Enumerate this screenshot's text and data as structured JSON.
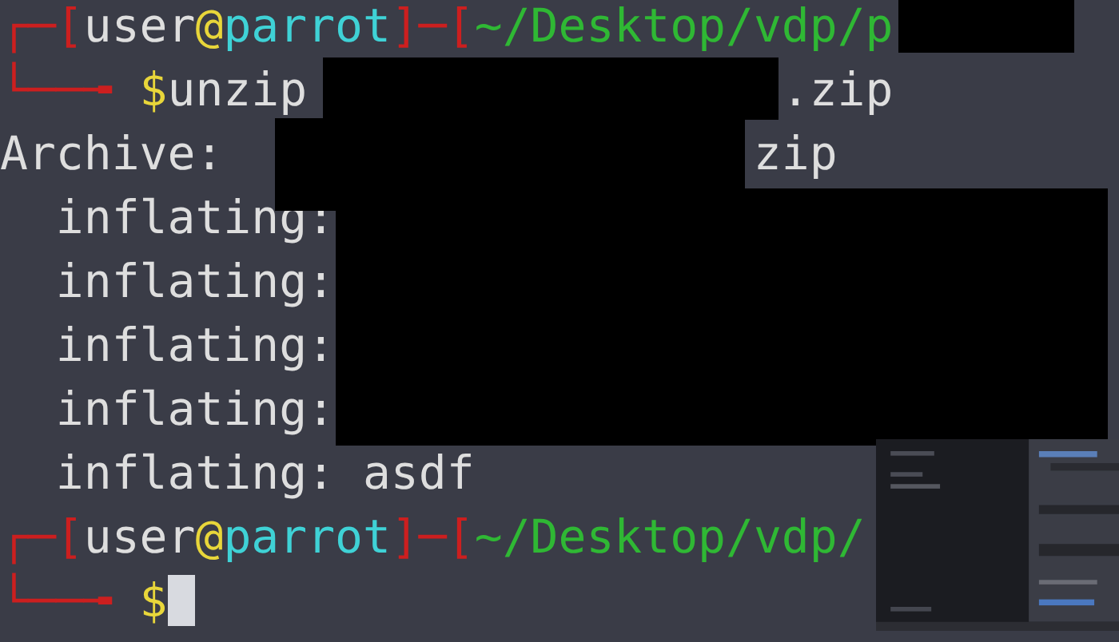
{
  "terminal": {
    "lines": [
      {
        "kind": "prompt_top",
        "segments": [
          {
            "kind": "frame",
            "text": "┌─["
          },
          {
            "kind": "user",
            "text": "user"
          },
          {
            "kind": "at",
            "text": "@"
          },
          {
            "kind": "host",
            "text": "parrot"
          },
          {
            "kind": "frame",
            "text": "]─["
          },
          {
            "kind": "path",
            "text": "~/Desktop/vdp/p"
          }
        ]
      },
      {
        "kind": "prompt_bottom",
        "segments": [
          {
            "kind": "frame",
            "text": "└──╼"
          },
          {
            "kind": "dollar",
            "text": "$"
          },
          {
            "kind": "command",
            "text": "unzip"
          },
          {
            "kind": "tail",
            "text": ".zip"
          }
        ]
      },
      {
        "kind": "output",
        "segments": [
          {
            "kind": "output",
            "text": "Archive:"
          },
          {
            "kind": "tail",
            "text": "zip"
          }
        ]
      },
      {
        "kind": "entry",
        "segments": [
          {
            "kind": "output",
            "text": "inflating:"
          }
        ]
      },
      {
        "kind": "entry",
        "segments": [
          {
            "kind": "output",
            "text": "inflating:"
          }
        ]
      },
      {
        "kind": "entry",
        "segments": [
          {
            "kind": "output",
            "text": "inflating:"
          }
        ]
      },
      {
        "kind": "entry",
        "segments": [
          {
            "kind": "output",
            "text": "inflating:"
          }
        ]
      },
      {
        "kind": "entry",
        "segments": [
          {
            "kind": "output",
            "text": "inflating: asdf"
          }
        ]
      },
      {
        "kind": "prompt_top",
        "segments": [
          {
            "kind": "frame",
            "text": "┌─["
          },
          {
            "kind": "user",
            "text": "user"
          },
          {
            "kind": "at",
            "text": "@"
          },
          {
            "kind": "host",
            "text": "parrot"
          },
          {
            "kind": "frame",
            "text": "]─["
          },
          {
            "kind": "path",
            "text": "~/Desktop/vdp/"
          }
        ]
      },
      {
        "kind": "prompt_bottom",
        "cursor": true,
        "segments": [
          {
            "kind": "frame",
            "text": "└──╼"
          },
          {
            "kind": "dollar",
            "text": "$"
          }
        ]
      }
    ]
  }
}
